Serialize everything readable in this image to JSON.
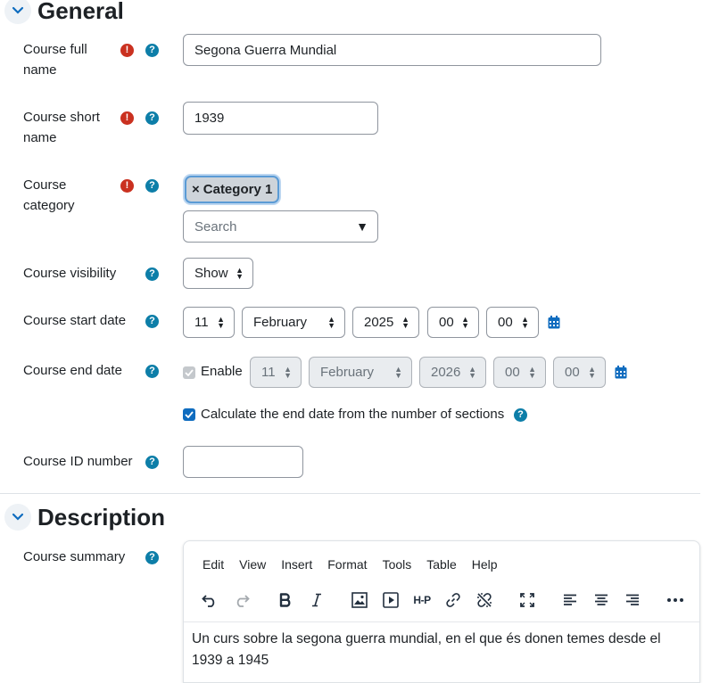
{
  "sections": {
    "general": "General",
    "description": "Description"
  },
  "fields": {
    "fullname": {
      "label_line1": "Course full",
      "label_line2": "name",
      "value": "Segona Guerra Mundial"
    },
    "shortname": {
      "label_line1": "Course short",
      "label_line2": "name",
      "value": "1939"
    },
    "category": {
      "label_line1": "Course",
      "label_line2": "category",
      "tag": "Category 1",
      "tag_remove": "×",
      "search_placeholder": "Search",
      "dropdown_arrow": "▼"
    },
    "visibility": {
      "label": "Course visibility",
      "value": "Show"
    },
    "startdate": {
      "label": "Course start date",
      "day": "11",
      "month": "February",
      "year": "2025",
      "hour": "00",
      "minute": "00"
    },
    "enddate": {
      "label": "Course end date",
      "enable_label": "Enable",
      "enable_checked": true,
      "day": "11",
      "month": "February",
      "year": "2026",
      "hour": "00",
      "minute": "00",
      "calc_label": "Calculate the end date from the number of sections",
      "calc_checked": true
    },
    "idnumber": {
      "label": "Course ID number",
      "value": ""
    },
    "summary": {
      "label": "Course summary"
    }
  },
  "icons": {
    "required": "!",
    "help": "?"
  },
  "editor": {
    "menu": [
      "Edit",
      "View",
      "Insert",
      "Format",
      "Tools",
      "Table",
      "Help"
    ],
    "content_line1": "Un curs sobre la segona guerra mundial, en el que és donen temes desde el",
    "content_line2": "1939 a 1945",
    "h5p_label": "H-P"
  },
  "colors": {
    "primary": "#0f6cbf",
    "help": "#0d7ea8",
    "required": "#ca3120"
  }
}
